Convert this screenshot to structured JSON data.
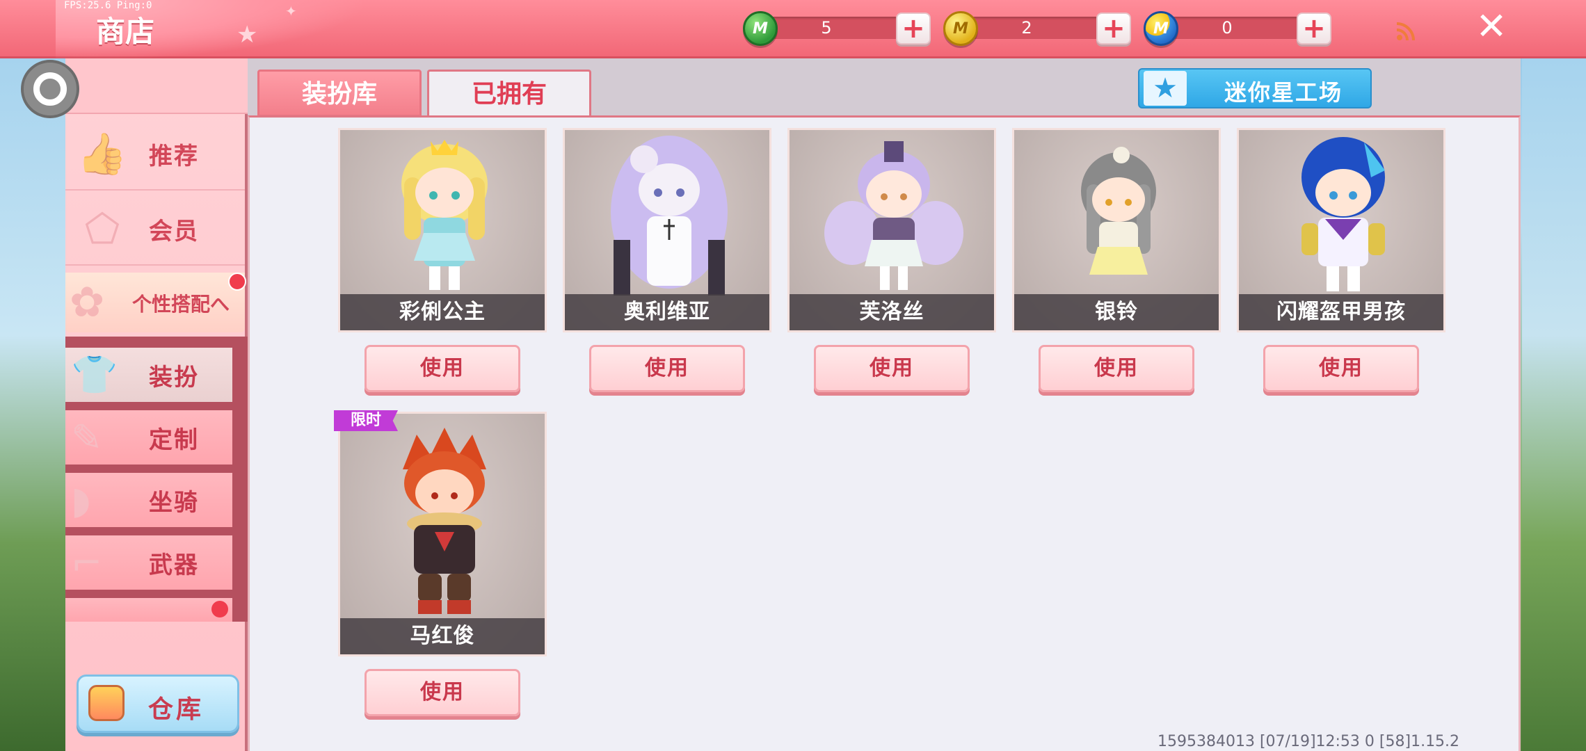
{
  "hud": {
    "fps_text": "FPS:25.6  Ping:0"
  },
  "header": {
    "title": "商店"
  },
  "currencies": [
    {
      "name": "mini-bean",
      "icon": "green-m-coin-icon",
      "color": "#2f9a3a",
      "value": "5"
    },
    {
      "name": "mini-coin",
      "icon": "gold-m-coin-icon",
      "color": "#e2b21a",
      "value": "2"
    },
    {
      "name": "star-coin",
      "icon": "blue-m-coin-icon",
      "color": "#1f64c4",
      "value": "0"
    }
  ],
  "sidebar": {
    "items": [
      {
        "label": "推荐",
        "icon": "thumbs-up-icon"
      },
      {
        "label": "会员",
        "icon": "vip-tag-icon"
      },
      {
        "label": "个性搭配へ",
        "icon": "swirl-icon"
      }
    ],
    "submenu": [
      {
        "label": "装扮",
        "icon": "shirt-icon"
      },
      {
        "label": "定制",
        "icon": "pencil-icon"
      },
      {
        "label": "坐骑",
        "icon": "saddle-icon"
      },
      {
        "label": "武器",
        "icon": "pistol-icon"
      }
    ],
    "warehouse_label": "仓库"
  },
  "tabs": [
    {
      "label": "装扮库",
      "active": false
    },
    {
      "label": "已拥有",
      "active": true
    }
  ],
  "mini_workshop": {
    "label": "迷你星工场",
    "icon": "star-icon"
  },
  "items": [
    {
      "name": "彩俐公主",
      "use_label": "使用"
    },
    {
      "name": "奥利维亚",
      "use_label": "使用"
    },
    {
      "name": "芙洛丝",
      "use_label": "使用"
    },
    {
      "name": "银铃",
      "use_label": "使用"
    },
    {
      "name": "闪耀盔甲男孩",
      "use_label": "使用"
    },
    {
      "name": "马红俊",
      "use_label": "使用",
      "badge": "限时"
    }
  ],
  "footer": {
    "info": "1595384013   [07/19]12:53 0   [58]1.15.2"
  },
  "colors": {
    "accent": "#f26877",
    "text_red": "#d24658",
    "limited_badge": "#c13bd7",
    "workshop_blue": "#2fa7e6"
  }
}
